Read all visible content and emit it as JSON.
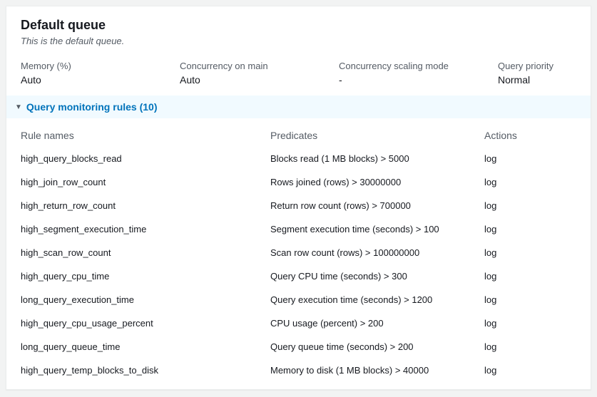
{
  "header": {
    "title": "Default queue",
    "subtitle": "This is the default queue."
  },
  "props": {
    "memory_label": "Memory (%)",
    "memory_value": "Auto",
    "concurrency_main_label": "Concurrency on main",
    "concurrency_main_value": "Auto",
    "concurrency_scaling_label": "Concurrency scaling mode",
    "concurrency_scaling_value": "-",
    "query_priority_label": "Query priority",
    "query_priority_value": "Normal"
  },
  "section": {
    "title": "Query monitoring rules (10)"
  },
  "columns": {
    "rule": "Rule names",
    "predicate": "Predicates",
    "action": "Actions"
  },
  "rules": [
    {
      "name": "high_query_blocks_read",
      "predicate": "Blocks read (1 MB blocks) > 5000",
      "action": "log"
    },
    {
      "name": "high_join_row_count",
      "predicate": "Rows joined (rows) > 30000000",
      "action": "log"
    },
    {
      "name": "high_return_row_count",
      "predicate": "Return row count (rows) > 700000",
      "action": "log"
    },
    {
      "name": "high_segment_execution_time",
      "predicate": "Segment execution time (seconds) > 100",
      "action": "log"
    },
    {
      "name": "high_scan_row_count",
      "predicate": "Scan row count (rows) > 100000000",
      "action": "log"
    },
    {
      "name": "high_query_cpu_time",
      "predicate": "Query CPU time (seconds) > 300",
      "action": "log"
    },
    {
      "name": "long_query_execution_time",
      "predicate": "Query execution time (seconds) > 1200",
      "action": "log"
    },
    {
      "name": "high_query_cpu_usage_percent",
      "predicate": "CPU usage (percent) > 200",
      "action": "log"
    },
    {
      "name": "long_query_queue_time",
      "predicate": "Query queue time (seconds) > 200",
      "action": "log"
    },
    {
      "name": "high_query_temp_blocks_to_disk",
      "predicate": "Memory to disk (1 MB blocks) > 40000",
      "action": "log"
    }
  ]
}
